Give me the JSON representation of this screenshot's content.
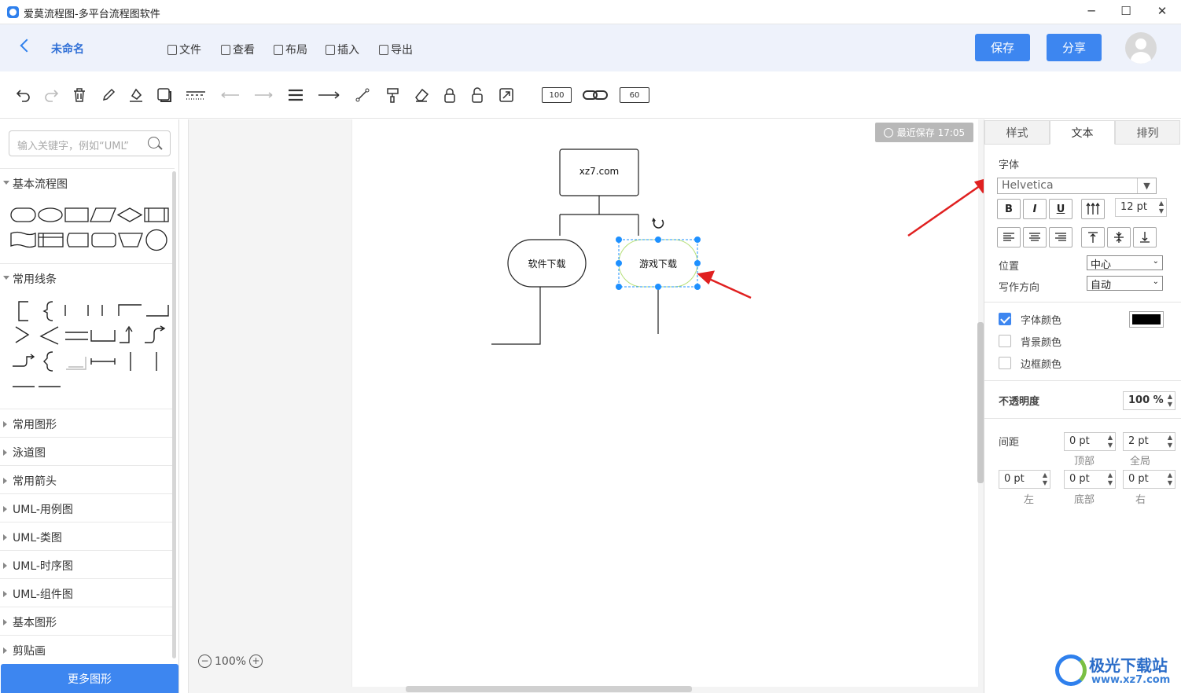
{
  "window": {
    "title": "爱莫流程图-多平台流程图软件",
    "minimize": "─",
    "maximize": "☐",
    "close": "✕"
  },
  "header": {
    "doc_title": "未命名",
    "menu": [
      "文件",
      "查看",
      "布局",
      "插入",
      "导出"
    ],
    "save_label": "保存",
    "share_label": "分享"
  },
  "toolbar": {
    "line_width": "100",
    "arrow_size": "60",
    "icons": [
      "undo-icon",
      "redo-icon",
      "delete-icon",
      "pen-icon",
      "fill-icon",
      "shadow-icon",
      "dash-line-icon",
      "arrow-left-icon",
      "arrow-right-icon",
      "line-weight-icon",
      "connector-icon",
      "waypoint-icon",
      "format-painter-icon",
      "eraser-icon",
      "lock-icon",
      "unlock-icon",
      "fit-icon",
      "link-icon"
    ]
  },
  "sidebar": {
    "search_placeholder": "输入关键字，例如“UML”",
    "sections": [
      {
        "label": "基本流程图",
        "expanded": true
      },
      {
        "label": "常用线条",
        "expanded": true
      },
      {
        "label": "常用图形",
        "expanded": false
      },
      {
        "label": "泳道图",
        "expanded": false
      },
      {
        "label": "常用箭头",
        "expanded": false
      },
      {
        "label": "UML-用例图",
        "expanded": false
      },
      {
        "label": "UML-类图",
        "expanded": false
      },
      {
        "label": "UML-时序图",
        "expanded": false
      },
      {
        "label": "UML-组件图",
        "expanded": false
      },
      {
        "label": "基本图形",
        "expanded": false
      },
      {
        "label": "剪贴画",
        "expanded": false
      }
    ],
    "more_label": "更多图形"
  },
  "canvas": {
    "save_status": "最近保存 17:05",
    "zoom": "100%",
    "nodes": {
      "root": "xz7.com",
      "left": "软件下载",
      "right": "游戏下载"
    }
  },
  "panel": {
    "tabs": [
      "样式",
      "文本",
      "排列"
    ],
    "active_tab": "文本",
    "font_section": "字体",
    "font_family": "Helvetica",
    "font_size": "12 pt",
    "bold": "B",
    "italic": "I",
    "underline": "U",
    "position_label": "位置",
    "position_value": "中心",
    "direction_label": "写作方向",
    "direction_value": "自动",
    "font_color_label": "字体颜色",
    "font_color_checked": true,
    "font_color": "#000000",
    "bg_color_label": "背景颜色",
    "bg_color_checked": false,
    "border_color_label": "边框颜色",
    "border_color_checked": false,
    "opacity_label": "不透明度",
    "opacity_value": "100 %",
    "spacing_label": "间距",
    "spacing": {
      "top": "0 pt",
      "global": "2 pt",
      "left": "0 pt",
      "bottom": "0 pt",
      "right": "0 pt"
    },
    "spacing_captions": {
      "top": "顶部",
      "global": "全局",
      "left": "左",
      "bottom": "底部",
      "right": "右"
    }
  },
  "watermark": {
    "text": "极光下载站",
    "url": "www.xz7.com"
  },
  "colors": {
    "accent": "#3d86f0",
    "annotation_arrow": "#e02020",
    "selection": "#1e90ff"
  }
}
